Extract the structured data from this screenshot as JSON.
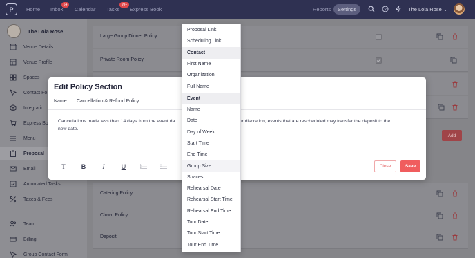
{
  "nav": {
    "home": "Home",
    "inbox": "Inbox",
    "inbox_badge": "64",
    "calendar": "Calendar",
    "tasks": "Tasks",
    "tasks_badge": "99+",
    "express_book": "Express Book",
    "reports": "Reports",
    "settings": "Settings",
    "venue_menu": "The Lola Rose",
    "icons": [
      "search-icon",
      "help-icon",
      "bolt-icon"
    ]
  },
  "sidebar": {
    "venue_name": "The Lola Rose",
    "items": [
      {
        "label": "Venue Details",
        "icon": "store-icon"
      },
      {
        "label": "Venue Profile",
        "icon": "layout-icon"
      },
      {
        "label": "Spaces",
        "icon": "spaces-icon"
      },
      {
        "label": "Contact Fo",
        "icon": "cursor-icon"
      },
      {
        "label": "Integratio",
        "icon": "box-icon"
      },
      {
        "label": "Express Bo",
        "icon": "cart-icon"
      },
      {
        "label": "Menu",
        "icon": "menu-icon"
      },
      {
        "label": "Proposal",
        "icon": "clipboard-icon"
      },
      {
        "label": "Email",
        "icon": "mail-icon"
      },
      {
        "label": "Automated Tasks",
        "icon": "check-icon"
      },
      {
        "label": "Taxes & Fees",
        "icon": "percent-icon"
      },
      {
        "label": "Team",
        "icon": "users-icon"
      },
      {
        "label": "Billing",
        "icon": "card-icon"
      },
      {
        "label": "Group Contact Form",
        "icon": "cursor-icon"
      }
    ]
  },
  "policies": {
    "rows": [
      {
        "label": "Large Group Dinner Policy"
      },
      {
        "label": "Private Room Policy"
      },
      {
        "label": ""
      },
      {
        "label": ""
      },
      {
        "label": "Catering Policy"
      },
      {
        "label": "Clown Policy"
      },
      {
        "label": "Deposit"
      }
    ],
    "add_label": "Add"
  },
  "modal": {
    "title": "Edit Policy Section",
    "name_label": "Name",
    "name_value": "Cancellation & Refund Policy",
    "body_text": "Cancellations made less than 14 days from the event date ... t our discretion, events that are rescheduled may transfer the deposit to the new date.",
    "body_line1_left": "Cancellations made less than 14 days from the event da",
    "body_line1_right": "t our discretion, events that are rescheduled may transfer the deposit to the",
    "body_line2": "new date.",
    "toolbar": [
      "text-icon",
      "bold-icon",
      "italic-icon",
      "underline-icon",
      "ordered-list-icon",
      "bullet-list-icon"
    ],
    "close_label": "Close",
    "save_label": "Save"
  },
  "dropdown": {
    "items": [
      {
        "label": "Proposal Link",
        "type": "item"
      },
      {
        "label": "Scheduling Link",
        "type": "item"
      },
      {
        "label": "Contact",
        "type": "header"
      },
      {
        "label": "First Name",
        "type": "item"
      },
      {
        "label": "Organization",
        "type": "item"
      },
      {
        "label": "Full Name",
        "type": "item"
      },
      {
        "label": "Event",
        "type": "header"
      },
      {
        "label": "Name",
        "type": "item"
      },
      {
        "label": "Date",
        "type": "item"
      },
      {
        "label": "Day of Week",
        "type": "item"
      },
      {
        "label": "Start Time",
        "type": "item"
      },
      {
        "label": "End Time",
        "type": "item"
      },
      {
        "label": "Group Size",
        "type": "item",
        "hovered": true
      },
      {
        "label": "Spaces",
        "type": "item"
      },
      {
        "label": "Rehearsal Date",
        "type": "item"
      },
      {
        "label": "Rehearsal Start Time",
        "type": "item"
      },
      {
        "label": "Rehearsal End Time",
        "type": "item"
      },
      {
        "label": "Tour Date",
        "type": "item"
      },
      {
        "label": "Tour Start Time",
        "type": "item"
      },
      {
        "label": "Tour End Time",
        "type": "item"
      }
    ]
  },
  "colors": {
    "nav_bg": "#2f3152",
    "accent_red": "#f05d5e",
    "overlay": "#858589"
  }
}
